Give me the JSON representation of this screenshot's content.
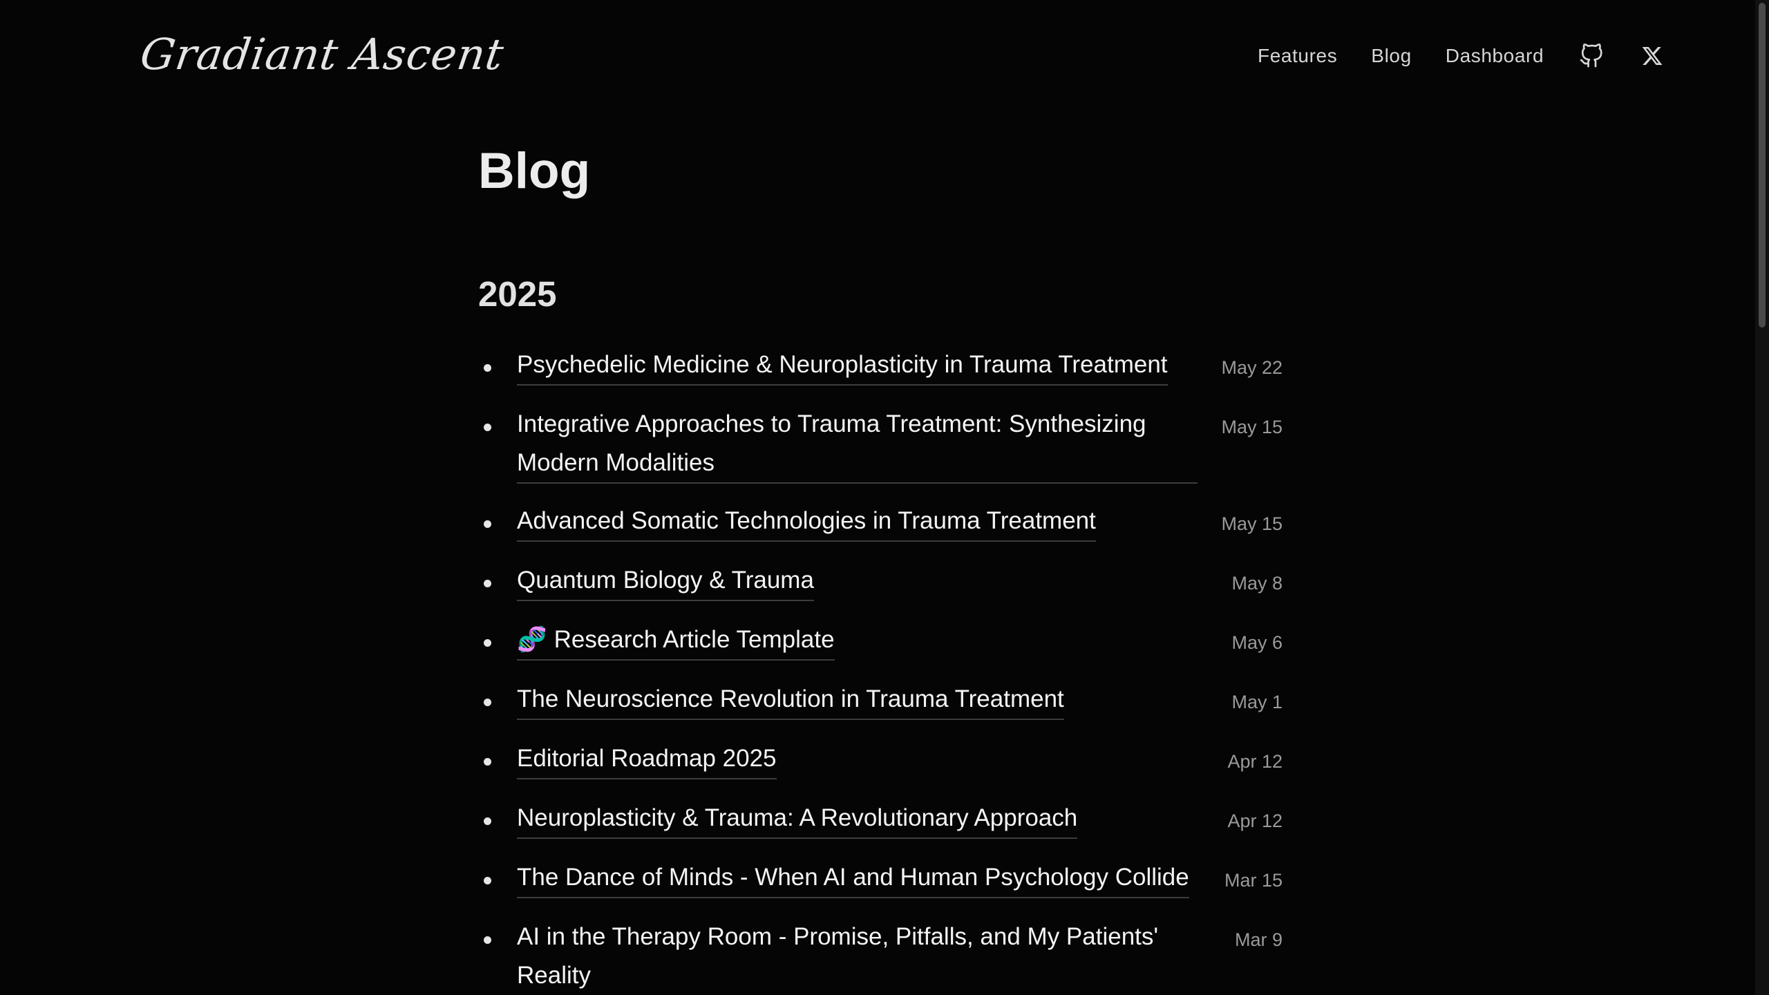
{
  "site": {
    "logo_text": "Gradiant Ascent"
  },
  "nav": {
    "links": [
      {
        "label": "Features"
      },
      {
        "label": "Blog"
      },
      {
        "label": "Dashboard"
      }
    ],
    "icons": [
      "github-icon",
      "x-twitter-icon"
    ]
  },
  "page": {
    "title": "Blog"
  },
  "year_group": {
    "year": "2025",
    "posts": [
      {
        "title": "Psychedelic Medicine & Neuroplasticity in Trauma Treatment",
        "date": "May 22"
      },
      {
        "title": "Integrative Approaches to Trauma Treatment: Synthesizing Modern Modalities",
        "date": "May 15"
      },
      {
        "title": "Advanced Somatic Technologies in Trauma Treatment",
        "date": "May 15"
      },
      {
        "title": "Quantum Biology & Trauma",
        "date": "May 8"
      },
      {
        "emoji": "🧬",
        "title": "Research Article Template",
        "date": "May 6"
      },
      {
        "title": "The Neuroscience Revolution in Trauma Treatment",
        "date": "May 1"
      },
      {
        "title": "Editorial Roadmap 2025",
        "date": "Apr 12"
      },
      {
        "title": "Neuroplasticity & Trauma: A Revolutionary Approach",
        "date": "Apr 12"
      },
      {
        "title": "The Dance of Minds - When AI and Human Psychology Collide",
        "date": "Mar 15"
      },
      {
        "title": "AI in the Therapy Room - Promise, Pitfalls, and My Patients' Reality",
        "date": "Mar 9"
      }
    ]
  },
  "colors": {
    "background": "#050505",
    "text": "#f4f4f4",
    "date": "#9a9a9a",
    "divider": "#3d3d3d"
  }
}
